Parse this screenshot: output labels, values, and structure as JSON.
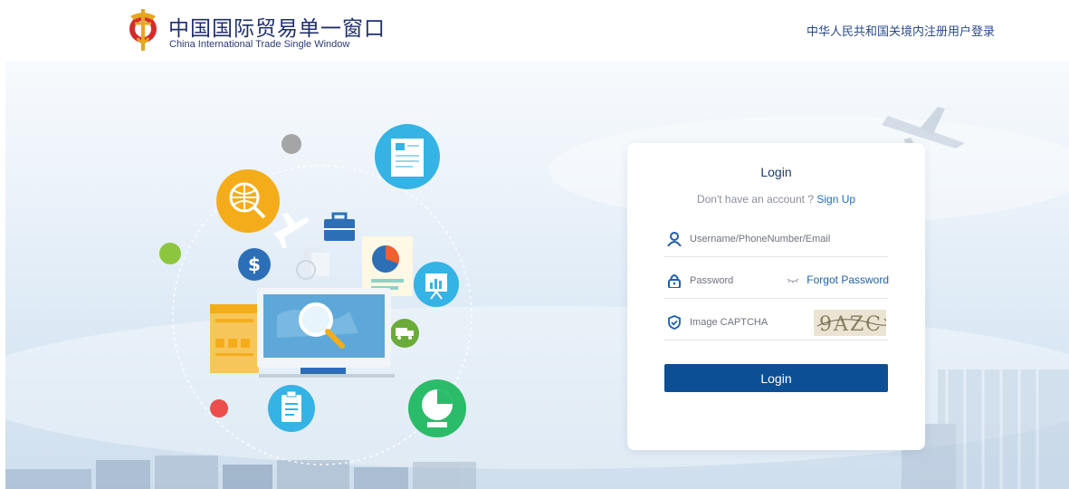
{
  "header": {
    "brand_cn": "中国国际贸易单一窗口",
    "brand_en": "China International Trade Single Window",
    "login_link": "中华人民共和国关境内注册用户登录"
  },
  "login": {
    "title": "Login",
    "signup_prompt": "Don't have an account ? ",
    "signup_link": "Sign Up",
    "username_placeholder": "Username/PhoneNumber/Email",
    "password_placeholder": "Password",
    "forgot_password": "Forgot Password",
    "captcha_placeholder": "Image CAPTCHA",
    "captcha_text": "9AZC",
    "button": "Login"
  },
  "icons": {
    "logo": "customs-emblem-icon",
    "user": "user-icon",
    "lock": "lock-icon",
    "shield": "shield-check-icon",
    "eye": "eye-closed-icon"
  },
  "colors": {
    "primary": "#0d4f94",
    "link": "#1f6fc2",
    "brand_text": "#1f2f6e"
  }
}
